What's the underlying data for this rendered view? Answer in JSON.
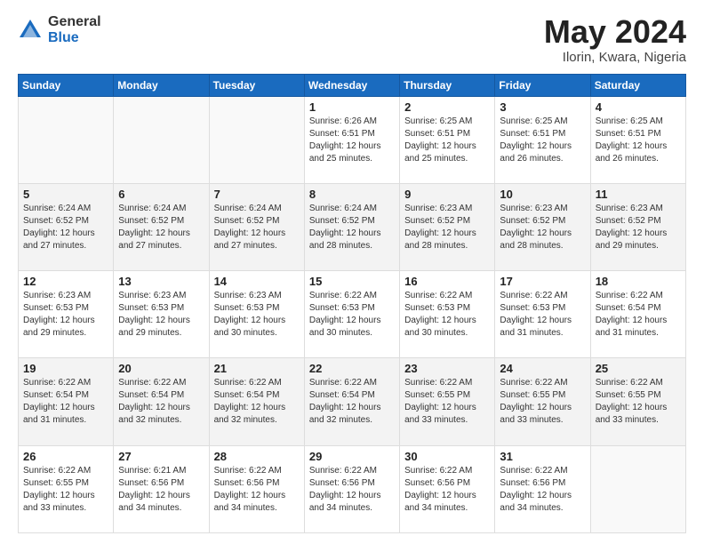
{
  "header": {
    "logo_general": "General",
    "logo_blue": "Blue",
    "month_title": "May 2024",
    "location": "Ilorin, Kwara, Nigeria"
  },
  "weekdays": [
    "Sunday",
    "Monday",
    "Tuesday",
    "Wednesday",
    "Thursday",
    "Friday",
    "Saturday"
  ],
  "weeks": [
    [
      {
        "day": "",
        "info": ""
      },
      {
        "day": "",
        "info": ""
      },
      {
        "day": "",
        "info": ""
      },
      {
        "day": "1",
        "info": "Sunrise: 6:26 AM\nSunset: 6:51 PM\nDaylight: 12 hours\nand 25 minutes."
      },
      {
        "day": "2",
        "info": "Sunrise: 6:25 AM\nSunset: 6:51 PM\nDaylight: 12 hours\nand 25 minutes."
      },
      {
        "day": "3",
        "info": "Sunrise: 6:25 AM\nSunset: 6:51 PM\nDaylight: 12 hours\nand 26 minutes."
      },
      {
        "day": "4",
        "info": "Sunrise: 6:25 AM\nSunset: 6:51 PM\nDaylight: 12 hours\nand 26 minutes."
      }
    ],
    [
      {
        "day": "5",
        "info": "Sunrise: 6:24 AM\nSunset: 6:52 PM\nDaylight: 12 hours\nand 27 minutes."
      },
      {
        "day": "6",
        "info": "Sunrise: 6:24 AM\nSunset: 6:52 PM\nDaylight: 12 hours\nand 27 minutes."
      },
      {
        "day": "7",
        "info": "Sunrise: 6:24 AM\nSunset: 6:52 PM\nDaylight: 12 hours\nand 27 minutes."
      },
      {
        "day": "8",
        "info": "Sunrise: 6:24 AM\nSunset: 6:52 PM\nDaylight: 12 hours\nand 28 minutes."
      },
      {
        "day": "9",
        "info": "Sunrise: 6:23 AM\nSunset: 6:52 PM\nDaylight: 12 hours\nand 28 minutes."
      },
      {
        "day": "10",
        "info": "Sunrise: 6:23 AM\nSunset: 6:52 PM\nDaylight: 12 hours\nand 28 minutes."
      },
      {
        "day": "11",
        "info": "Sunrise: 6:23 AM\nSunset: 6:52 PM\nDaylight: 12 hours\nand 29 minutes."
      }
    ],
    [
      {
        "day": "12",
        "info": "Sunrise: 6:23 AM\nSunset: 6:53 PM\nDaylight: 12 hours\nand 29 minutes."
      },
      {
        "day": "13",
        "info": "Sunrise: 6:23 AM\nSunset: 6:53 PM\nDaylight: 12 hours\nand 29 minutes."
      },
      {
        "day": "14",
        "info": "Sunrise: 6:23 AM\nSunset: 6:53 PM\nDaylight: 12 hours\nand 30 minutes."
      },
      {
        "day": "15",
        "info": "Sunrise: 6:22 AM\nSunset: 6:53 PM\nDaylight: 12 hours\nand 30 minutes."
      },
      {
        "day": "16",
        "info": "Sunrise: 6:22 AM\nSunset: 6:53 PM\nDaylight: 12 hours\nand 30 minutes."
      },
      {
        "day": "17",
        "info": "Sunrise: 6:22 AM\nSunset: 6:53 PM\nDaylight: 12 hours\nand 31 minutes."
      },
      {
        "day": "18",
        "info": "Sunrise: 6:22 AM\nSunset: 6:54 PM\nDaylight: 12 hours\nand 31 minutes."
      }
    ],
    [
      {
        "day": "19",
        "info": "Sunrise: 6:22 AM\nSunset: 6:54 PM\nDaylight: 12 hours\nand 31 minutes."
      },
      {
        "day": "20",
        "info": "Sunrise: 6:22 AM\nSunset: 6:54 PM\nDaylight: 12 hours\nand 32 minutes."
      },
      {
        "day": "21",
        "info": "Sunrise: 6:22 AM\nSunset: 6:54 PM\nDaylight: 12 hours\nand 32 minutes."
      },
      {
        "day": "22",
        "info": "Sunrise: 6:22 AM\nSunset: 6:54 PM\nDaylight: 12 hours\nand 32 minutes."
      },
      {
        "day": "23",
        "info": "Sunrise: 6:22 AM\nSunset: 6:55 PM\nDaylight: 12 hours\nand 33 minutes."
      },
      {
        "day": "24",
        "info": "Sunrise: 6:22 AM\nSunset: 6:55 PM\nDaylight: 12 hours\nand 33 minutes."
      },
      {
        "day": "25",
        "info": "Sunrise: 6:22 AM\nSunset: 6:55 PM\nDaylight: 12 hours\nand 33 minutes."
      }
    ],
    [
      {
        "day": "26",
        "info": "Sunrise: 6:22 AM\nSunset: 6:55 PM\nDaylight: 12 hours\nand 33 minutes."
      },
      {
        "day": "27",
        "info": "Sunrise: 6:21 AM\nSunset: 6:56 PM\nDaylight: 12 hours\nand 34 minutes."
      },
      {
        "day": "28",
        "info": "Sunrise: 6:22 AM\nSunset: 6:56 PM\nDaylight: 12 hours\nand 34 minutes."
      },
      {
        "day": "29",
        "info": "Sunrise: 6:22 AM\nSunset: 6:56 PM\nDaylight: 12 hours\nand 34 minutes."
      },
      {
        "day": "30",
        "info": "Sunrise: 6:22 AM\nSunset: 6:56 PM\nDaylight: 12 hours\nand 34 minutes."
      },
      {
        "day": "31",
        "info": "Sunrise: 6:22 AM\nSunset: 6:56 PM\nDaylight: 12 hours\nand 34 minutes."
      },
      {
        "day": "",
        "info": ""
      }
    ]
  ]
}
